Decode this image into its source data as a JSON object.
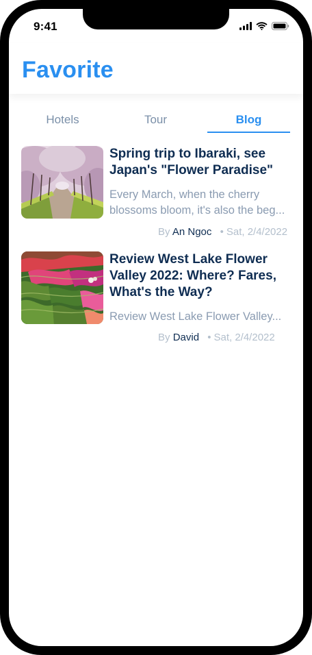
{
  "status_bar": {
    "time": "9:41"
  },
  "header": {
    "title": "Favorite"
  },
  "tabs": [
    {
      "label": "Hotels",
      "active": false
    },
    {
      "label": "Tour",
      "active": false
    },
    {
      "label": "Blog",
      "active": true
    }
  ],
  "posts": [
    {
      "title": "Spring trip to Ibaraki, see Japan's \"Flower Paradise\"",
      "excerpt": "Every March, when the cherry blossoms bloom, it's also the beg...",
      "by_label": "By",
      "author": "An Ngoc",
      "date": "Sat, 2/4/2022",
      "image": "cherry-blossom-avenue"
    },
    {
      "title": "Review West Lake Flower Valley 2022: Where? Fares, What's the Way?",
      "excerpt": "Review West Lake Flower Valley...",
      "by_label": "By",
      "author": "David",
      "date": "Sat, 2/4/2022",
      "image": "flower-valley-aerial"
    }
  ],
  "colors": {
    "accent": "#2a8ff0",
    "title_text": "#0f2d52",
    "muted_text": "#8a9bb1"
  }
}
